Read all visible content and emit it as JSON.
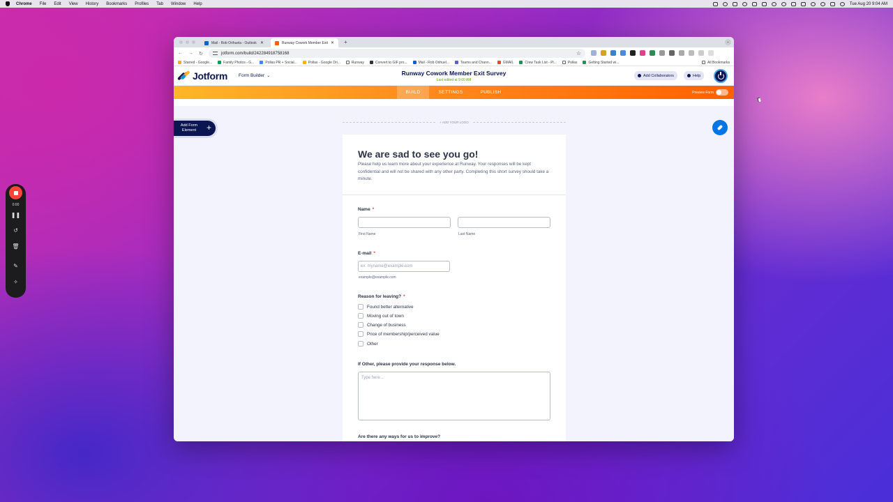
{
  "menubar": {
    "app": "Chrome",
    "items": [
      "File",
      "Edit",
      "View",
      "History",
      "Bookmarks",
      "Profiles",
      "Tab",
      "Window",
      "Help"
    ],
    "clock": "Tue Aug 20  9:04 AM"
  },
  "browser": {
    "tabs": [
      {
        "title": "Mail - Rob Orihuela - Outlook",
        "favicon_color": "#0a64c8"
      },
      {
        "title": "Runway Cowork Member Exit Survey",
        "favicon_color": "#ff6100"
      }
    ],
    "url": "jotform.com/build/242284918758168",
    "bookmarks": [
      "Starred - Google...",
      "Family Photos - G...",
      "Pollas PR + Social...",
      "Pollas - Google Dri...",
      "Runway",
      "Convert to GIF pro...",
      "Mail - Rob Orihuel...",
      "Teams and Chann...",
      "GMAIL",
      "Crew Task List - Pl...",
      "Pollas",
      "Getting Started wi..."
    ],
    "all_bookmarks": "All Bookmarks"
  },
  "jotform": {
    "brand": "Jotform",
    "form_builder": "Form Builder",
    "form_title": "Runway Cowork Member Exit Survey",
    "last_edited": "Last edited at 9:00 AM",
    "add_collaborators": "Add Collaborators",
    "help": "Help",
    "nav": {
      "build": "BUILD",
      "settings": "SETTINGS",
      "publish": "PUBLISH"
    },
    "preview_form": "Preview Form",
    "add_form_element": "Add Form Element",
    "add_logo": "+ ADD YOUR LOGO"
  },
  "form": {
    "heading": "We are sad to see you go!",
    "intro": "Please help us learn more about your experience at Runway. Your responses will be kept confidential and will not be shared with any other party. Completing this short survey should take a minute.",
    "name_label": "Name",
    "first_name": "First Name",
    "last_name": "Last Name",
    "email_label": "E-mail",
    "email_placeholder": "ex: myname@example.com",
    "email_hint": "example@example.com",
    "reason_label": "Reason for leaving?",
    "reasons": [
      "Found better alternative",
      "Moving out of town",
      "Change of business",
      "Price of membership/perceived value",
      "Other"
    ],
    "other_label": "If Other, please provide your response below.",
    "other_placeholder": "Type here...",
    "improve_label": "Are there any ways for us to improve?",
    "required_mark": "*"
  },
  "recorder": {
    "time": "0:00"
  },
  "colors": {
    "brand_navy": "#0a1551",
    "brand_orange": "#ff6100",
    "brand_yellow": "#ffb629",
    "designer_blue": "#0075e3",
    "record_red": "#ff453a"
  }
}
